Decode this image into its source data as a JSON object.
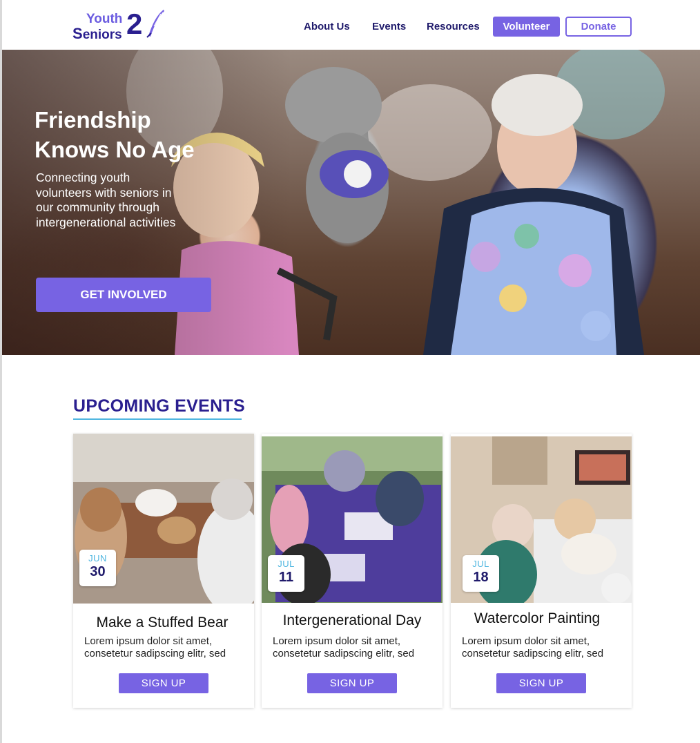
{
  "logo": {
    "word1": "Youth",
    "word2_cap": "S",
    "word2_rest": "eniors",
    "numeral": "2"
  },
  "nav": {
    "about": "About Us",
    "events": "Events",
    "resources": "Resources",
    "volunteer": "Volunteer",
    "donate": "Donate"
  },
  "hero": {
    "title_line1": "Friendship",
    "title_line2": "Knows No Age",
    "subtitle": "Connecting youth volunteers with seniors in our community through intergenerational activities",
    "cta": "GET INVOLVED"
  },
  "events": {
    "heading": "UPCOMING EVENTS",
    "items": [
      {
        "month": "JUN",
        "day": "30",
        "title": "Make a Stuffed Bear",
        "description": "Lorem ipsum dolor sit amet, consetetur sadipscing elitr, sed",
        "button": "SIGN UP"
      },
      {
        "month": "JUL",
        "day": "11",
        "title": "Intergenerational Day",
        "description": "Lorem ipsum dolor sit amet, consetetur sadipscing elitr, sed",
        "button": "SIGN UP"
      },
      {
        "month": "JUL",
        "day": "18",
        "title": "Watercolor Painting",
        "description": "Lorem ipsum dolor sit amet, consetetur sadipscing elitr, sed",
        "button": "SIGN UP"
      }
    ]
  },
  "colors": {
    "brand_purple": "#7763e3",
    "brand_navy": "#2a1f8f",
    "accent_cyan": "#4fb6e0"
  },
  "icons": {
    "logo_mark": "quill-feather-icon"
  }
}
